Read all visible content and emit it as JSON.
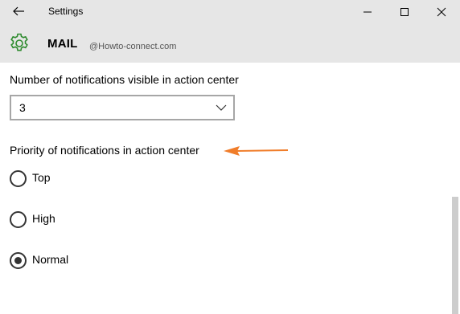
{
  "titlebar": {
    "title": "Settings",
    "back_icon": "back-arrow-icon",
    "minimize_icon": "minimize-icon",
    "maximize_icon": "maximize-icon",
    "close_icon": "close-icon"
  },
  "header": {
    "app_icon": "gear-icon",
    "app_name": "MAIL",
    "watermark": "@Howto-connect.com"
  },
  "settings": {
    "count_label": "Number of notifications visible in action center",
    "count_value": "3",
    "priority_label": "Priority of notifications in action center",
    "priority_options": [
      {
        "label": "Top",
        "selected": false
      },
      {
        "label": "High",
        "selected": false
      },
      {
        "label": "Normal",
        "selected": true
      }
    ]
  },
  "colors": {
    "titlebar_bg": "#e6e6e6",
    "accent_gear": "#2e8b2e",
    "arrow": "#f07d2a",
    "scroll_thumb": "#cdcdcd"
  }
}
